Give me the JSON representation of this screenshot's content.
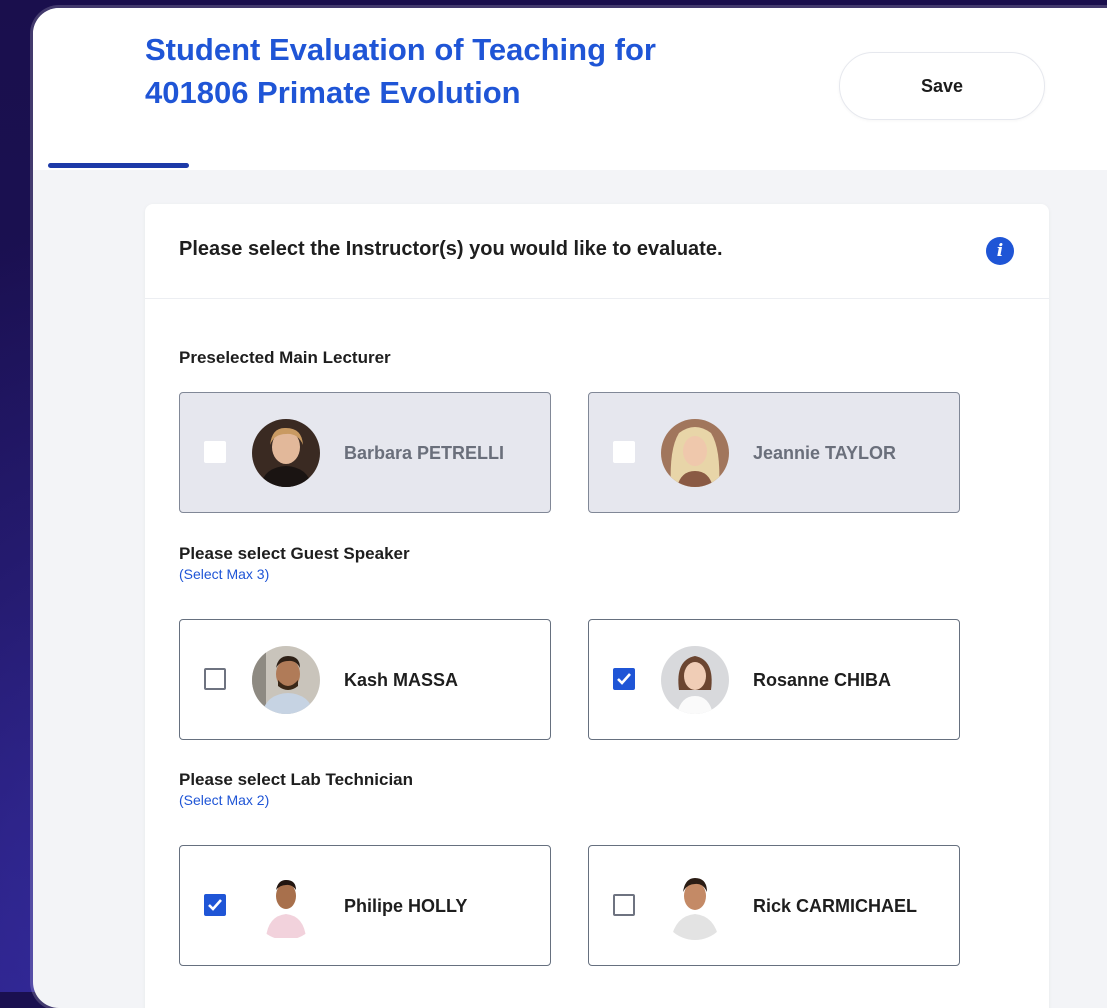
{
  "page": {
    "title": "Student Evaluation of Teaching for 401806 Primate Evolution",
    "save_label": "Save"
  },
  "card": {
    "question": "Please select the Instructor(s) you would like to evaluate.",
    "info_icon": "info-icon",
    "sections": [
      {
        "title": "Preselected Main Lecturer",
        "note": "",
        "instructors": [
          {
            "name": "Barbara PETRELLI",
            "checked": false,
            "disabled": true
          },
          {
            "name": "Jeannie TAYLOR",
            "checked": false,
            "disabled": true
          }
        ]
      },
      {
        "title": "Please select Guest Speaker",
        "note": "(Select Max 3)",
        "instructors": [
          {
            "name": "Kash MASSA",
            "checked": false,
            "disabled": false
          },
          {
            "name": "Rosanne CHIBA",
            "checked": true,
            "disabled": false
          }
        ]
      },
      {
        "title": "Please select Lab Technician",
        "note": "(Select Max 2)",
        "instructors": [
          {
            "name": "Philipe HOLLY",
            "checked": true,
            "disabled": false
          },
          {
            "name": "Rick CARMICHAEL",
            "checked": false,
            "disabled": false
          }
        ]
      }
    ]
  },
  "colors": {
    "accent": "#1f55d6",
    "background": "#1a1050",
    "tile_disabled": "#e6e7ee"
  }
}
